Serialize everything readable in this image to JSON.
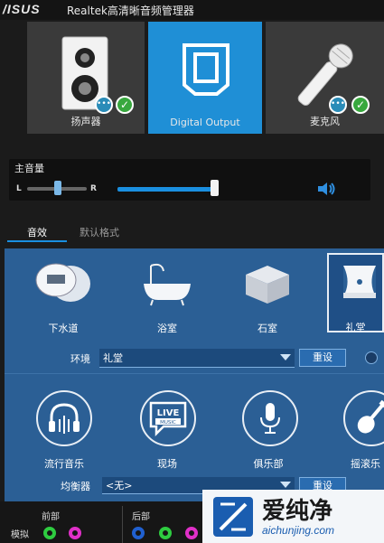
{
  "window": {
    "logo": "/ISUS",
    "title": "Realtek高清晰音频管理器"
  },
  "devices": [
    {
      "label": "扬声器",
      "icon": "speaker-icon"
    },
    {
      "label": "Digital Output",
      "icon": "digital-output-icon",
      "active": true
    },
    {
      "label": "麦克风",
      "icon": "microphone-icon"
    }
  ],
  "volume": {
    "label": "主音量",
    "left": "L",
    "right": "R",
    "level": 0.96,
    "balance": 0.5
  },
  "tabs": [
    {
      "label": "音效",
      "active": true
    },
    {
      "label": "默认格式",
      "active": false
    }
  ],
  "environment": {
    "items": [
      {
        "label": "下水道"
      },
      {
        "label": "浴室"
      },
      {
        "label": "石室"
      },
      {
        "label": "礼堂",
        "selected": true
      }
    ],
    "label": "环境",
    "value": "礼堂",
    "reset": "重设"
  },
  "equalizer": {
    "items": [
      {
        "label": "流行音乐"
      },
      {
        "label": "现场"
      },
      {
        "label": "俱乐部"
      },
      {
        "label": "摇滚乐"
      }
    ],
    "label": "均衡器",
    "value": "<无>",
    "reset": "重设"
  },
  "connectors": {
    "front": "前部",
    "rear": "后部",
    "analog": "模拟"
  },
  "watermark": {
    "text": "爱纯净",
    "url": "aichunjing.com"
  },
  "colors": {
    "accent": "#1a8fe0",
    "panel": "#2b5f95",
    "green_jack": "#2ecc40",
    "pink_jack": "#e030c8",
    "blue_jack": "#2060d0"
  }
}
